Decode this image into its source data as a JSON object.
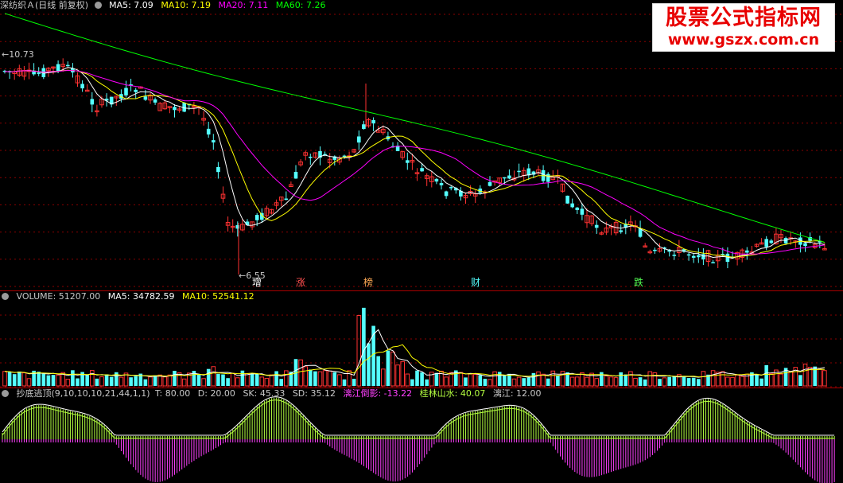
{
  "price_panel": {
    "stock_name": "深纺织Ａ(日线 前复权)",
    "ma5": "MA5: 7.09",
    "ma10": "MA10: 7.19",
    "ma20": "MA20: 7.11",
    "ma60": "MA60: 7.26",
    "high_marker": "10.73",
    "low_marker": "6.55",
    "events": [
      "增",
      "涨",
      "榜",
      "财",
      "跌"
    ]
  },
  "volume_panel": {
    "volume": "VOLUME: 51207.00",
    "ma5": "MA5: 34782.59",
    "ma10": "MA10: 52541.12"
  },
  "indicator_panel": {
    "name": "抄底逃顶(9,10,10,10,21,44,1,1)",
    "t": "T: 80.00",
    "d": "D: 20.00",
    "sk": "SK: 45.33",
    "sd": "SD: 35.12",
    "lijiang_daoying": "漓江倒影: -13.22",
    "guilin_shanshui": "桂林山水: 40.07",
    "lijiang": "漓江: 12.00"
  },
  "watermark": {
    "title": "股票公式指标网",
    "url": "www.gszx.com.cn"
  },
  "colors": {
    "up": "#ff3232",
    "down": "#54ffff",
    "ma5": "#ffffff",
    "ma10": "#ffff00",
    "ma20": "#ff00ff",
    "ma60": "#00ff00",
    "grid": "#8b0000",
    "green_hist": "#b4ff40",
    "magenta_hist": "#ff40ff"
  }
}
